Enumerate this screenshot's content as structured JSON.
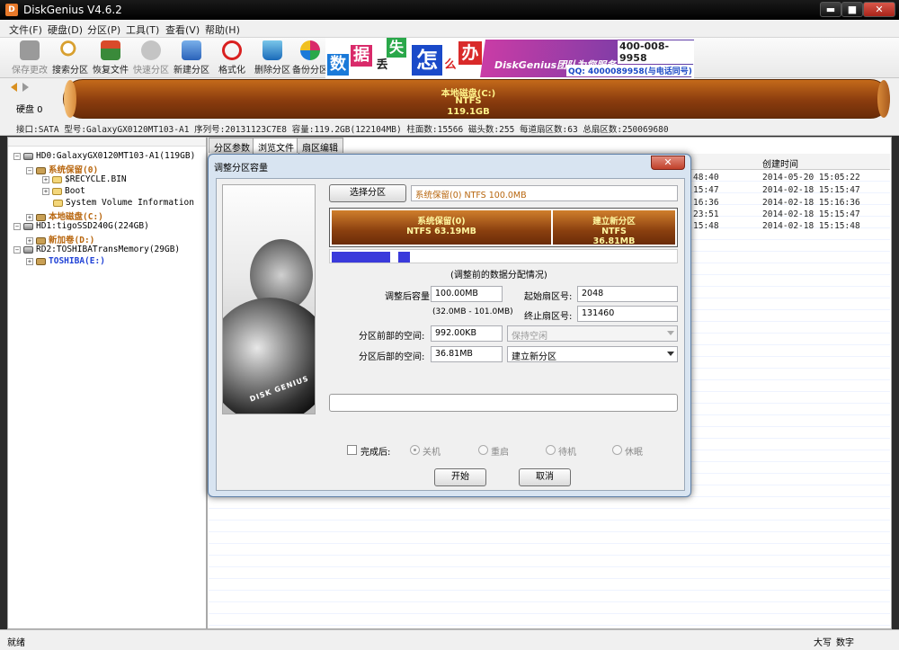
{
  "window": {
    "title": "DiskGenius V4.6.2",
    "icon": "D",
    "minimize": "▬",
    "maximize": "■",
    "close": "✕"
  },
  "menu": [
    "文件(F)",
    "硬盘(D)",
    "分区(P)",
    "工具(T)",
    "查看(V)",
    "帮助(H)"
  ],
  "toolbar": [
    {
      "label": "保存更改",
      "icon": "save-icon",
      "color": "#7a7a7a",
      "disabled": true
    },
    {
      "label": "搜索分区",
      "icon": "search-icon",
      "color": "#d8a030"
    },
    {
      "label": "恢复文件",
      "icon": "restore-icon",
      "color": "#3a8a3a"
    },
    {
      "label": "快速分区",
      "icon": "quick-partition-icon",
      "color": "#a0a0a0",
      "disabled": true
    },
    {
      "label": "新建分区",
      "icon": "new-partition-icon",
      "color": "#3a78c9"
    },
    {
      "label": "格式化",
      "icon": "format-icon",
      "color": "#d92020"
    },
    {
      "label": "删除分区",
      "icon": "delete-partition-icon",
      "color": "#3a9ad9"
    },
    {
      "label": "备份分区",
      "icon": "backup-icon",
      "color": "#c95aa8"
    }
  ],
  "banner": {
    "chars": [
      {
        "c": "数",
        "bg": "#1a7ad9",
        "fg": "#fff"
      },
      {
        "c": "据",
        "bg": "#d92a6a",
        "fg": "#fff"
      },
      {
        "c": "丢",
        "bg": "#fff",
        "fg": "#222"
      },
      {
        "c": "失",
        "bg": "#2aa84a",
        "fg": "#fff"
      },
      {
        "c": "怎",
        "bg": "#1a4ac9",
        "fg": "#fff"
      },
      {
        "c": "么",
        "bg": "#fff",
        "fg": "#d92020"
      },
      {
        "c": "办",
        "bg": "#d92a2a",
        "fg": "#fff"
      }
    ],
    "brand": "DiskGenius团队为您服务",
    "phone1": "400-008-9958",
    "phone2": "QQ: 4000089958(与电话同号)"
  },
  "disk_bar": {
    "label": "硬盘 0",
    "partition_name": "本地磁盘(C:)",
    "fs": "NTFS",
    "size": "119.1GB"
  },
  "disk_info": "接口:SATA  型号:GalaxyGX0120MT103-A1  序列号:20131123C7E8  容量:119.2GB(122104MB)  柱面数:15566  磁头数:255  每道扇区数:63  总扇区数:250069680",
  "tree": [
    {
      "text": "HD0:GalaxyGX0120MT103-A1(119GB)",
      "level": 0,
      "type": "hdd",
      "exp": "−"
    },
    {
      "text": "系统保留(0)",
      "level": 1,
      "type": "part",
      "exp": "−",
      "style": "orange"
    },
    {
      "text": "$RECYCLE.BIN",
      "level": 2,
      "type": "folder",
      "exp": "+"
    },
    {
      "text": "Boot",
      "level": 2,
      "type": "folder",
      "exp": "+"
    },
    {
      "text": "System Volume Information",
      "level": 2,
      "type": "folder",
      "exp": ""
    },
    {
      "text": "本地磁盘(C:)",
      "level": 1,
      "type": "part",
      "exp": "+",
      "style": "orange"
    },
    {
      "text": "HD1:tigoSSD240G(224GB)",
      "level": 0,
      "type": "hdd",
      "exp": "−"
    },
    {
      "text": "新加卷(D:)",
      "level": 1,
      "type": "part",
      "exp": "+",
      "style": "orange"
    },
    {
      "text": "RD2:TOSHIBATransMemory(29GB)",
      "level": 0,
      "type": "hdd",
      "exp": "−"
    },
    {
      "text": "TOSHIBA(E:)",
      "level": 1,
      "type": "part",
      "exp": "+",
      "style": "blue"
    }
  ],
  "tabs": [
    "分区参数",
    "浏览文件",
    "扇区编辑"
  ],
  "active_tab": 1,
  "file_columns": {
    "created": "创建时间"
  },
  "file_rows": [
    {
      "left": "48:40",
      "created": "2014-05-20 15:05:22"
    },
    {
      "left": "15:47",
      "created": "2014-02-18 15:15:47"
    },
    {
      "left": "16:36",
      "created": "2014-02-18 15:16:36"
    },
    {
      "left": "23:51",
      "created": "2014-02-18 15:15:47"
    },
    {
      "left": "15:48",
      "created": "2014-02-18 15:15:48"
    }
  ],
  "status": {
    "left": "就绪",
    "caps": "大写",
    "num": "数字"
  },
  "dialog": {
    "title": "调整分区容量",
    "close": "✕",
    "select_partition_button": "选择分区",
    "selected_partition": "系统保留(0) NTFS 100.0MB",
    "segments": [
      {
        "name": "系统保留(0)",
        "info": "NTFS 63.19MB",
        "fraction": 0.64
      },
      {
        "name": "建立新分区",
        "info": "NTFS",
        "size": "36.81MB",
        "fraction": 0.36
      }
    ],
    "usage_fraction": 0.23,
    "usage_caption": "(调整前的数据分配情况)",
    "size_after_label": "调整后容量:",
    "size_after_value": "100.00MB",
    "size_range": "(32.0MB - 101.0MB)",
    "start_sector_label": "起始扇区号:",
    "start_sector_value": "2048",
    "end_sector_label": "终止扇区号:",
    "end_sector_value": "131460",
    "space_before_label": "分区前部的空间:",
    "space_before_value": "992.00KB",
    "space_before_action": "保持空闲",
    "space_after_label": "分区后部的空间:",
    "space_after_value": "36.81MB",
    "space_after_action": "建立新分区",
    "done_label": "完成后:",
    "radios": [
      "关机",
      "重启",
      "待机",
      "休眠"
    ],
    "start_button": "开始",
    "cancel_button": "取消",
    "image_logo": "DISK GENIUS"
  }
}
